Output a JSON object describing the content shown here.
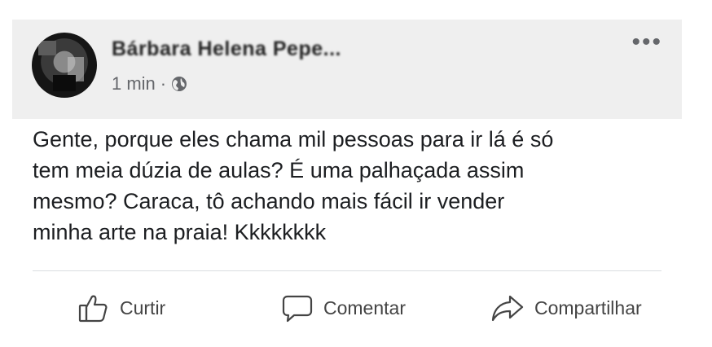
{
  "post": {
    "author_name": "Bárbara Helena Pepe...",
    "timestamp": "1 min",
    "separator": "·",
    "privacy_icon": "globe-icon",
    "more_icon": "more-options-icon",
    "more_label": "•••",
    "text": "Gente, porque eles chama mil pessoas para ir lá é só\ntem meia dúzia de aulas? É uma palhaçada assim\nmesmo? Caraca, tô achando mais fácil ir vender\nminha arte na praia! Kkkkkkkk"
  },
  "actions": {
    "like_label": "Curtir",
    "comment_label": "Comentar",
    "share_label": "Compartilhar"
  },
  "colors": {
    "header_bg": "#efefef",
    "text": "#1c1e21",
    "muted": "#65676b"
  }
}
